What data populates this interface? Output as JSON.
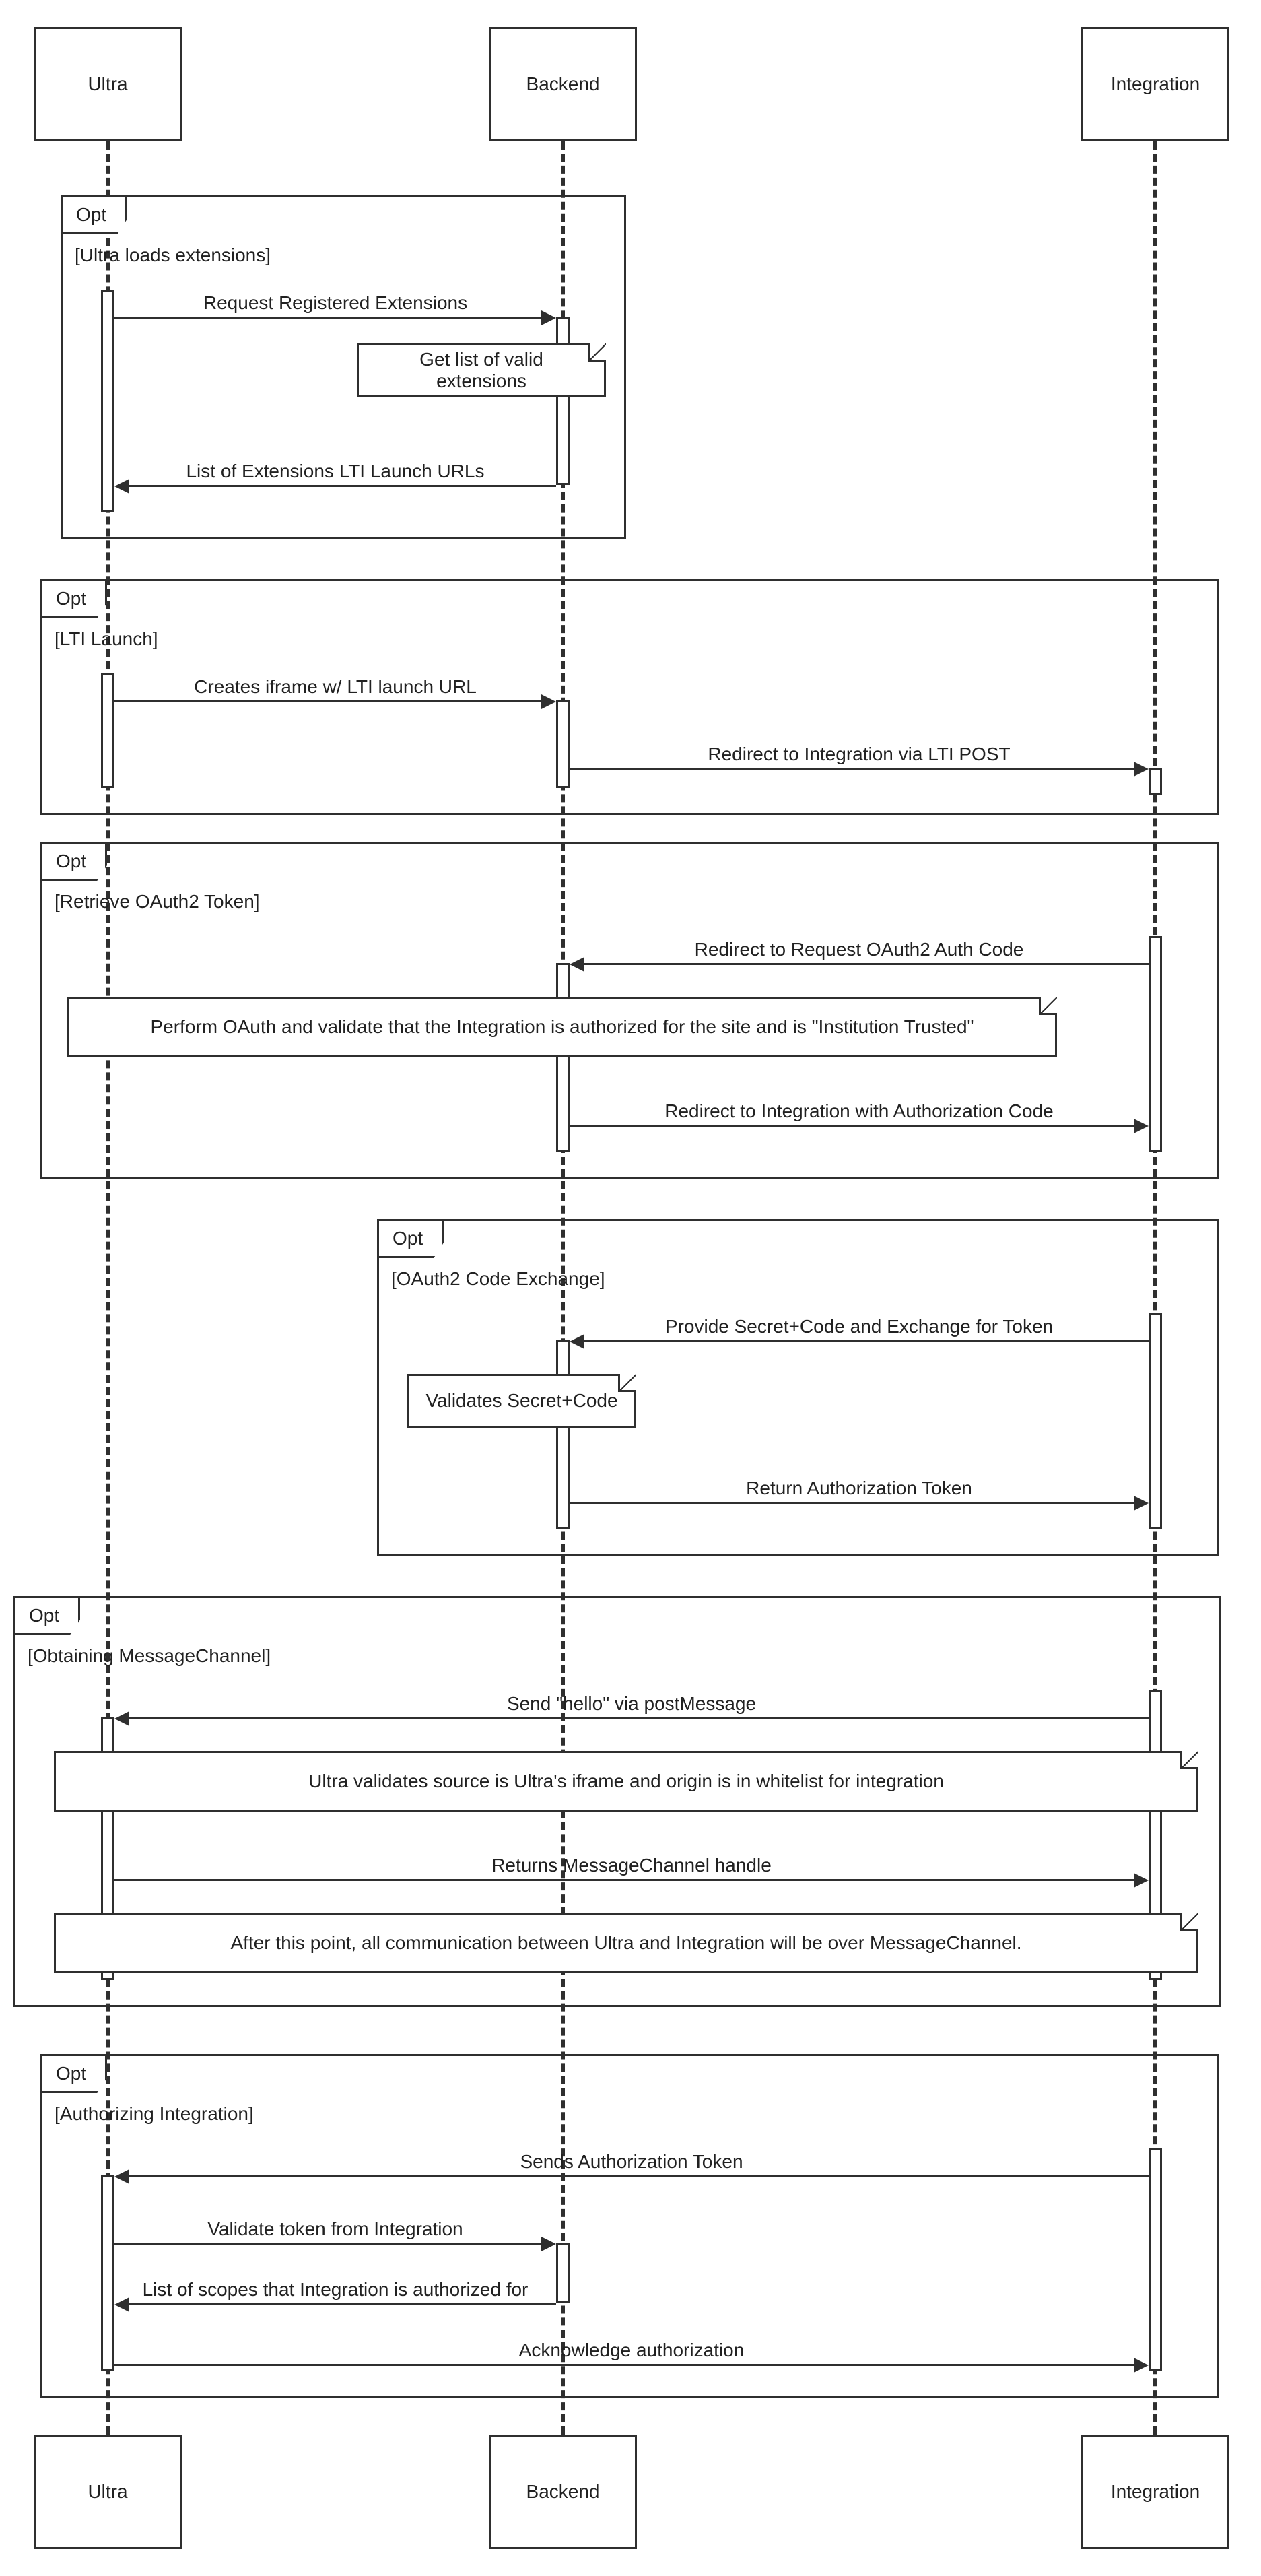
{
  "participants": {
    "ultra": "Ultra",
    "backend": "Backend",
    "integration": "Integration"
  },
  "frames": {
    "f1": {
      "label": "Opt",
      "condition": "[Ultra loads extensions]"
    },
    "f2": {
      "label": "Opt",
      "condition": "[LTI Launch]"
    },
    "f3": {
      "label": "Opt",
      "condition": "[Retrieve OAuth2 Token]"
    },
    "f4": {
      "label": "Opt",
      "condition": "[OAuth2 Code Exchange]"
    },
    "f5": {
      "label": "Opt",
      "condition": "[Obtaining MessageChannel]"
    },
    "f6": {
      "label": "Opt",
      "condition": "[Authorizing Integration]"
    }
  },
  "messages": {
    "m1": "Request Registered Extensions",
    "m2": "List of Extensions LTI Launch URLs",
    "m3": "Creates iframe w/ LTI launch URL",
    "m4": "Redirect to Integration via LTI POST",
    "m5": "Redirect to Request OAuth2 Auth Code",
    "m6": "Redirect to Integration with Authorization Code",
    "m7": "Provide Secret+Code and Exchange for Token",
    "m8": "Return Authorization Token",
    "m9": "Send \"hello\" via postMessage",
    "m10": "Returns MessageChannel handle",
    "m11": "Sends Authorization Token",
    "m12": "Validate token from Integration",
    "m13": "List of scopes that Integration is authorized for",
    "m14": "Acknowledge authorization"
  },
  "notes": {
    "n1": "Get list of valid extensions",
    "n2": "Perform OAuth and validate that the Integration is authorized for the site and is \"Institution Trusted\"",
    "n3": "Validates Secret+Code",
    "n4": "Ultra validates source is Ultra's iframe and origin is in whitelist for integration",
    "n5": "After this point, all communication between Ultra and Integration will be over MessageChannel."
  }
}
